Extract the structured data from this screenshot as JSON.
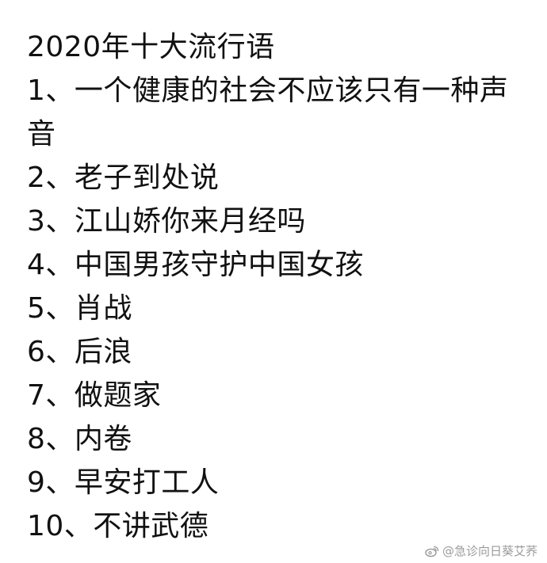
{
  "document": {
    "title": "2020年十大流行语",
    "items": [
      "1、一个健康的社会不应该只有一种声音",
      "2、老子到处说",
      "3、江山娇你来月经吗",
      "4、中国男孩守护中国女孩",
      "5、肖战",
      "6、后浪",
      "7、做题家",
      "8、内卷",
      "9、早安打工人",
      "10、不讲武德"
    ]
  },
  "watermark": {
    "text": "@急诊向日葵艾荞",
    "icon": "weibo-icon",
    "color": "#9a9a9a"
  },
  "colors": {
    "background": "#ffffff",
    "text": "#111111"
  }
}
